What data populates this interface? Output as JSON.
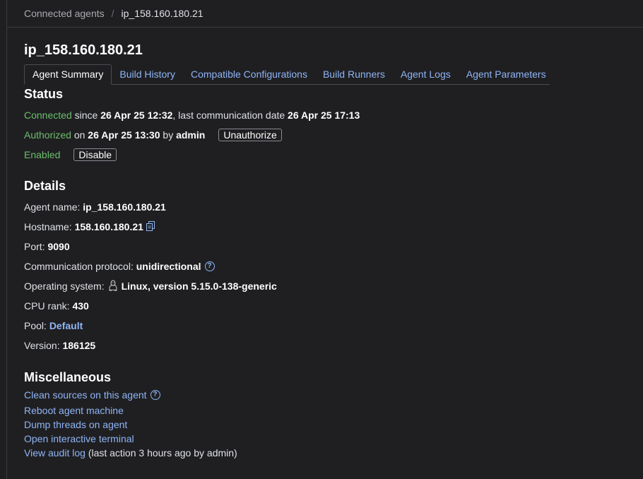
{
  "breadcrumb": {
    "parent": "Connected agents",
    "separator": "/",
    "current": "ip_158.160.180.21"
  },
  "page_title": "ip_158.160.180.21",
  "tabs": [
    {
      "label": "Agent Summary"
    },
    {
      "label": "Build History"
    },
    {
      "label": "Compatible Configurations"
    },
    {
      "label": "Build Runners"
    },
    {
      "label": "Agent Logs"
    },
    {
      "label": "Agent Parameters"
    }
  ],
  "status": {
    "heading": "Status",
    "connected": "Connected",
    "since_text": "since",
    "since_date": "26 Apr 25 12:32",
    "last_comm_text": ", last communication date",
    "last_comm_date": "26 Apr 25 17:13",
    "authorized": "Authorized",
    "on_text": "on",
    "auth_date": "26 Apr 25 13:30",
    "by_text": "by",
    "auth_user": "admin",
    "unauthorize_label": "Unauthorize",
    "enabled": "Enabled",
    "disable_label": "Disable",
    "accent_color": "#6cbf6a"
  },
  "details": {
    "heading": "Details",
    "agent_name_label": "Agent name:",
    "agent_name": "ip_158.160.180.21",
    "hostname_label": "Hostname:",
    "hostname": "158.160.180.21",
    "port_label": "Port:",
    "port": "9090",
    "protocol_label": "Communication protocol:",
    "protocol": "unidirectional",
    "os_label": "Operating system:",
    "os_icon": "linux-penguin-icon",
    "os": "Linux, version 5.15.0-138-generic",
    "cpu_label": "CPU rank:",
    "cpu": "430",
    "pool_label": "Pool:",
    "pool": "Default",
    "version_label": "Version:",
    "version": "186125"
  },
  "misc": {
    "heading": "Miscellaneous",
    "clean_sources": "Clean sources on this agent",
    "reboot": "Reboot agent machine",
    "dump_threads": "Dump threads on agent",
    "terminal": "Open interactive terminal",
    "audit_log": "View audit log",
    "audit_note": "(last action 3 hours ago by admin)"
  },
  "colors": {
    "background": "#1f1f22",
    "link": "#8fb5f5",
    "text": "#dfe1e5"
  }
}
